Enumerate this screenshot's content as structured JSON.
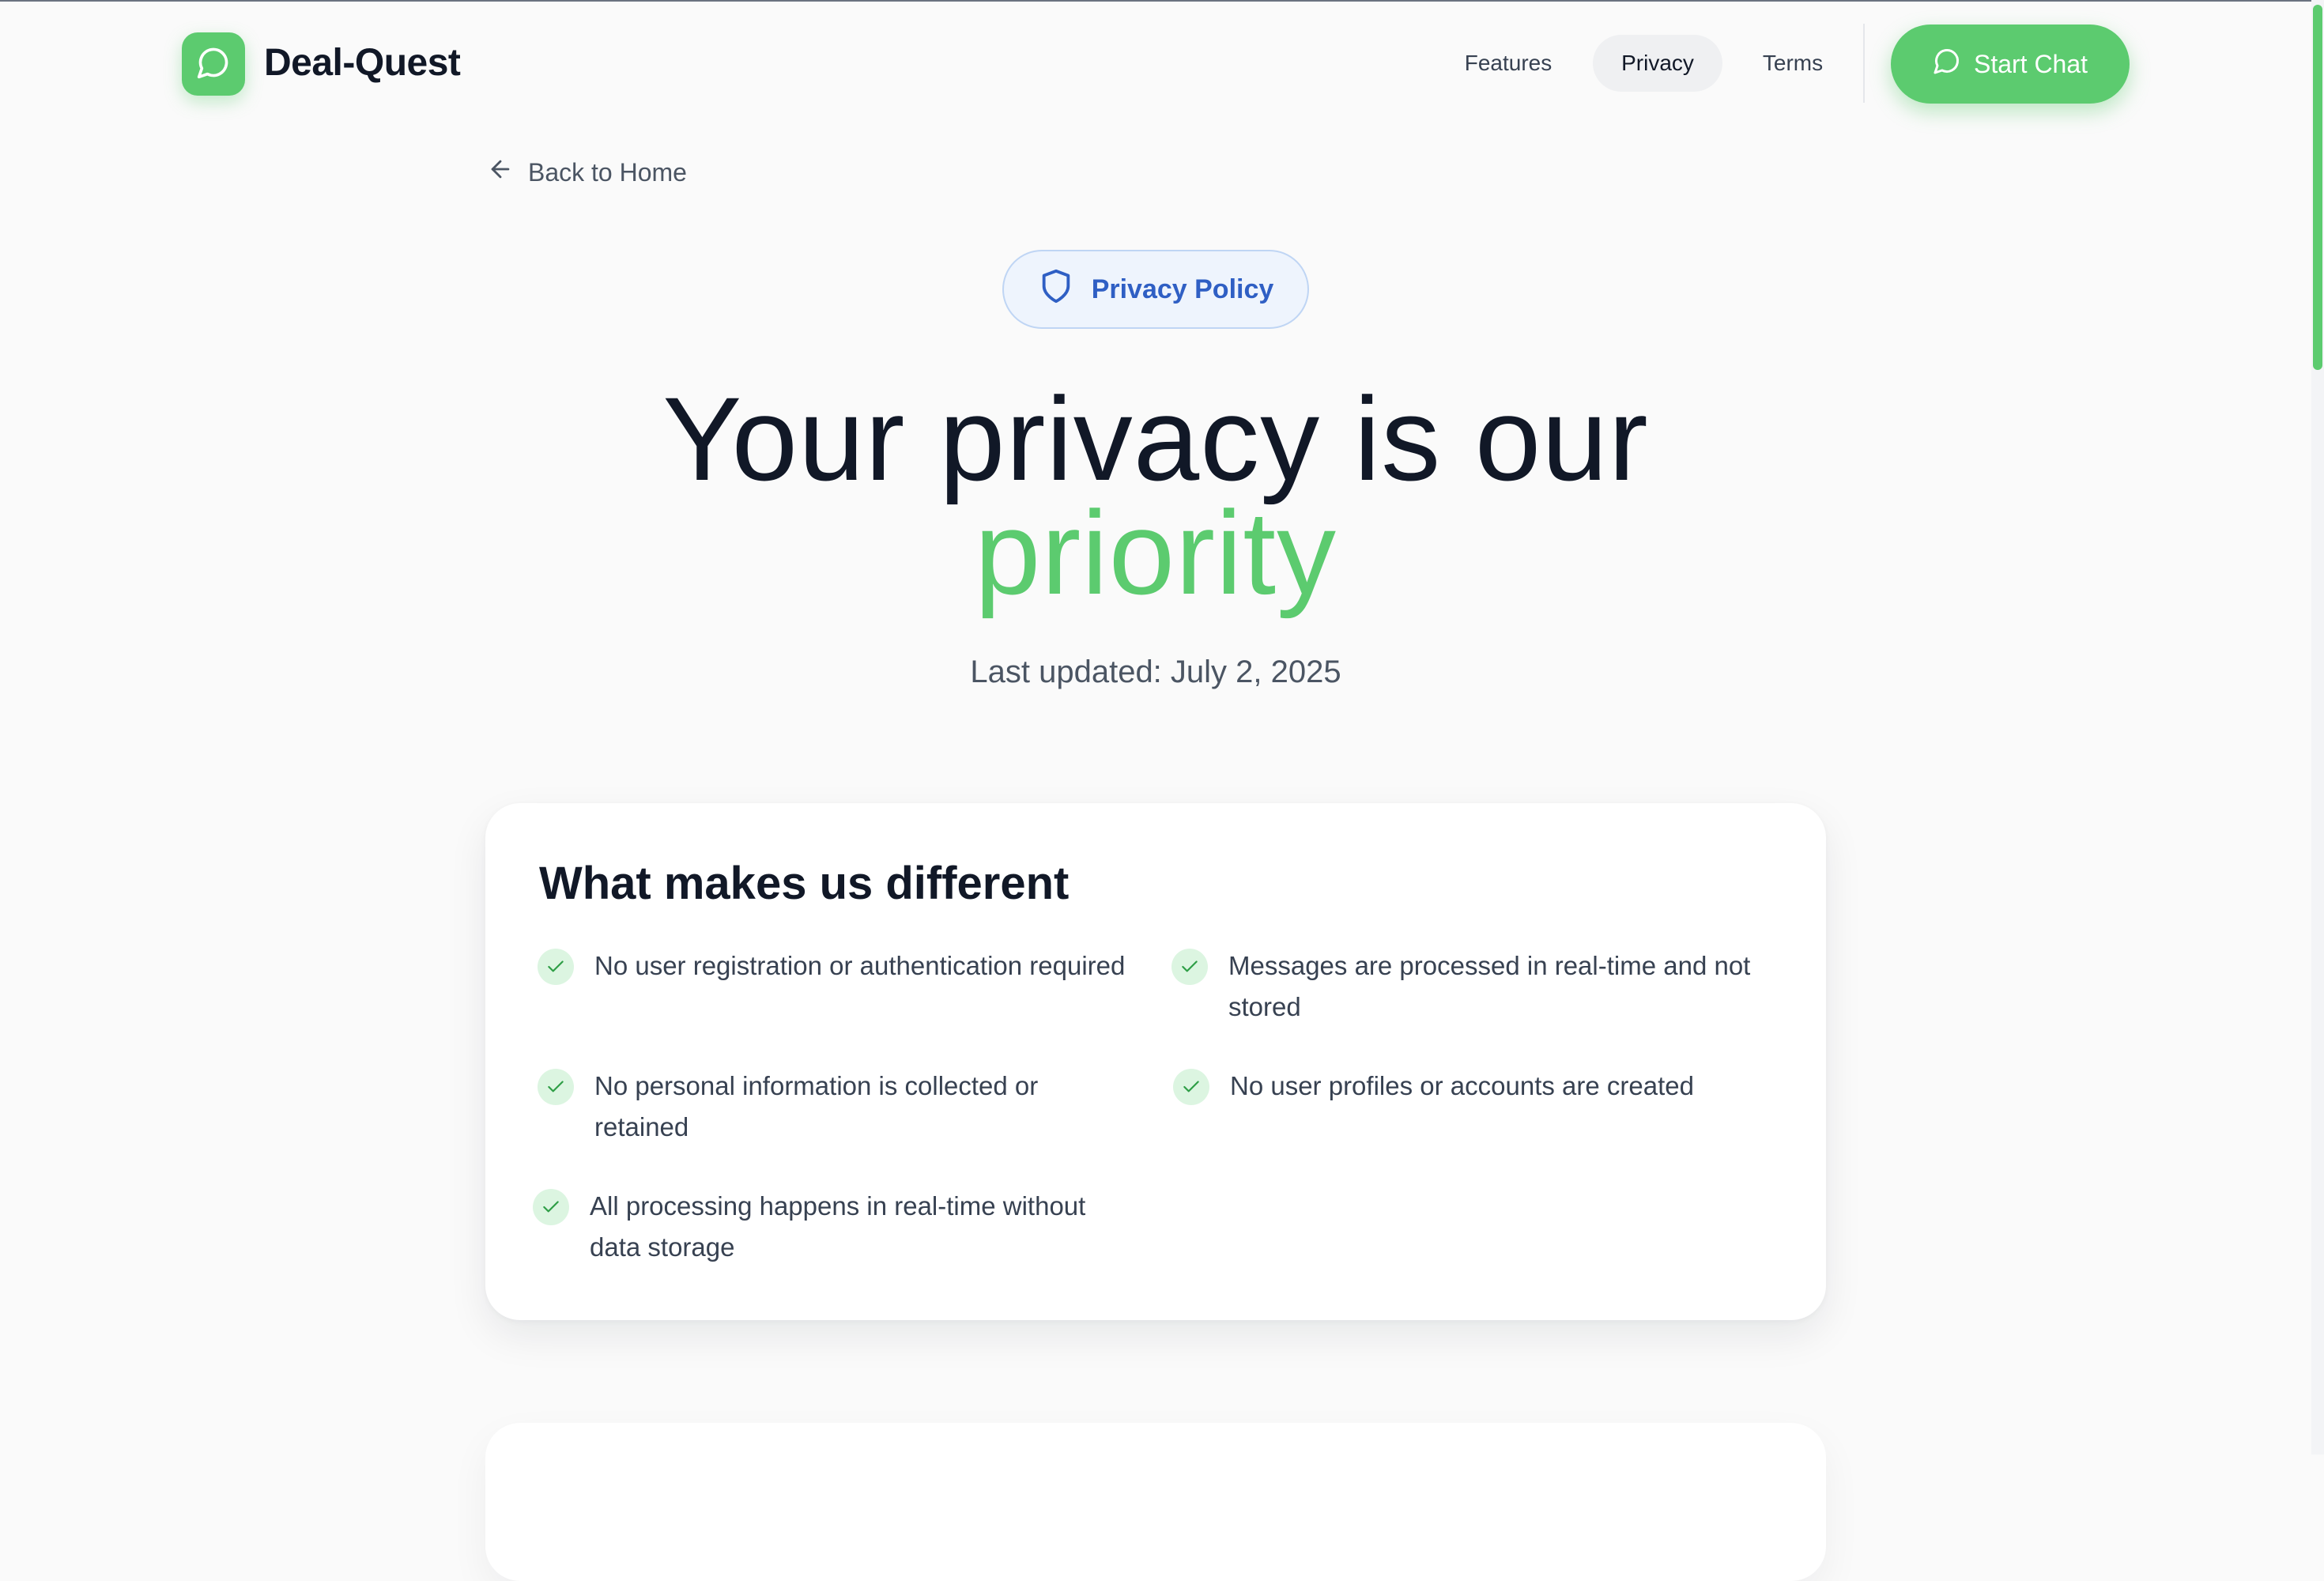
{
  "header": {
    "brand": "Deal-Quest",
    "logo_icon": "chat-bubble-icon",
    "nav": [
      {
        "label": "Features",
        "active": false
      },
      {
        "label": "Privacy",
        "active": true
      },
      {
        "label": "Terms",
        "active": false
      }
    ],
    "cta_label": "Start Chat",
    "cta_icon": "chat-bubble-icon"
  },
  "back_link": {
    "label": "Back to Home",
    "icon": "arrow-left-icon"
  },
  "badge": {
    "label": "Privacy Policy",
    "icon": "shield-icon"
  },
  "hero": {
    "line1": "Your privacy is our",
    "line2": "priority",
    "updated": "Last updated: July 2, 2025"
  },
  "card": {
    "title": "What makes us different",
    "features": [
      "No user registration or authentication required",
      "Messages are processed in real-time and not stored",
      "No personal information is collected or retained",
      "No user profiles or accounts are created",
      "All processing happens in real-time without data storage"
    ],
    "check_icon": "check-icon"
  },
  "colors": {
    "accent": "#5ccb6f",
    "badge_text": "#2f5fc4",
    "badge_bg": "#eef4fd",
    "text_dark": "#111827",
    "text_muted": "#4b5563"
  }
}
